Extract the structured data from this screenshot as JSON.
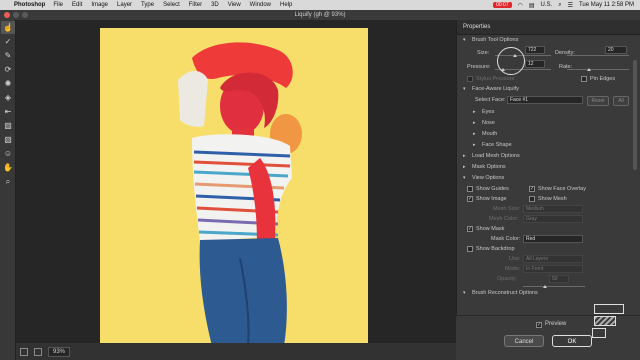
{
  "menubar": {
    "app": "Photoshop",
    "items": [
      "File",
      "Edit",
      "Image",
      "Layer",
      "Type",
      "Select",
      "Filter",
      "3D",
      "View",
      "Window",
      "Help"
    ],
    "rec": "00:07",
    "locale": "U.S.",
    "datetime": "Tue May 11  2:58 PM"
  },
  "window_title": "Liquify (gh @ 93%)",
  "status": {
    "zoom": "93%"
  },
  "panel": {
    "title": "Properties",
    "brush_tool_options": "Brush Tool Options",
    "size_label": "Size:",
    "size_value": "722",
    "density_label": "Density:",
    "density_value": "20",
    "pressure_label": "Pressure:",
    "pressure_value": "12",
    "rate_label": "Rate:",
    "stylus_pressure": "Stylus Pressure",
    "pin_edges": "Pin Edges",
    "face_aware": "Face-Aware Liquify",
    "select_face_label": "Select Face:",
    "select_face_value": "Face #1",
    "reset": "Reset",
    "all": "All",
    "eyes": "Eyes",
    "nose": "Nose",
    "mouth": "Mouth",
    "face_shape": "Face Shape",
    "load_mesh": "Load Mesh Options",
    "mask_options": "Mask Options",
    "view_options": "View Options",
    "show_guides": "Show Guides",
    "show_face_overlay": "Show Face Overlay",
    "show_image": "Show Image",
    "show_mesh": "Show Mesh",
    "mesh_size_label": "Mesh Size:",
    "mesh_size_value": "Medium",
    "mesh_color_label": "Mesh Color:",
    "mesh_color_value": "Gray",
    "show_mask": "Show Mask",
    "mask_color_label": "Mask Color:",
    "mask_color_value": "Red",
    "show_backdrop": "Show Backdrop",
    "use_label": "Use:",
    "use_value": "All Layers",
    "mode_label": "Mode:",
    "mode_value": "In Front",
    "opacity_label": "Opacity:",
    "opacity_value": "50",
    "brush_reconstruct": "Brush Reconstruct Options",
    "preview": "Preview",
    "cancel": "Cancel",
    "ok": "OK"
  },
  "colors": {
    "canvas_bg": "#f7de6a",
    "mask": "#e8242d",
    "accent": "#1f6fd6"
  }
}
